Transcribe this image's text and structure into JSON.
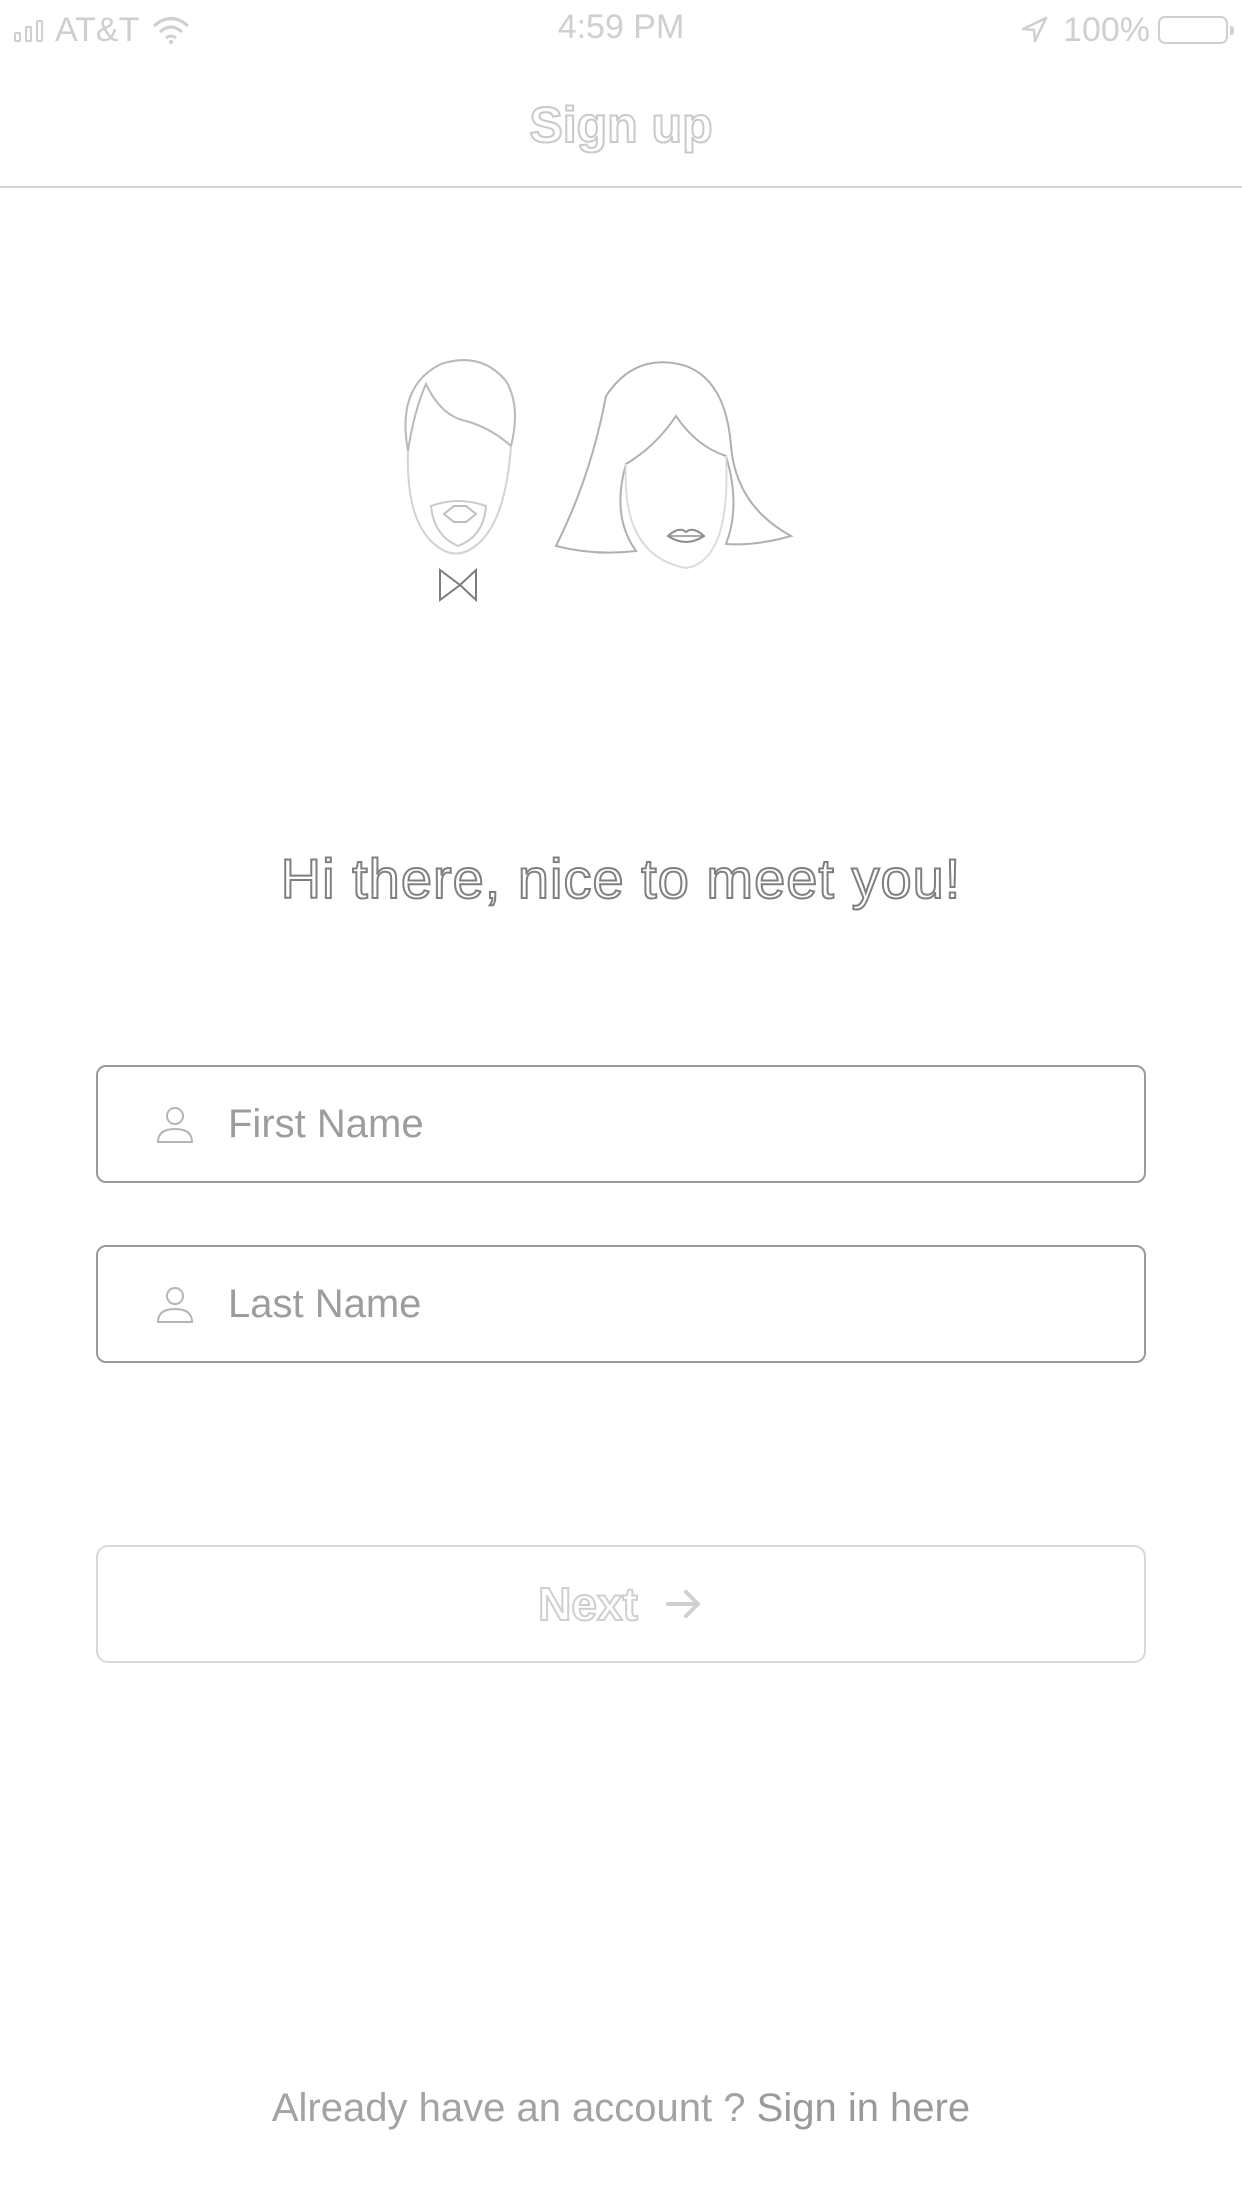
{
  "status_bar": {
    "carrier": "AT&T",
    "time": "4:59 PM",
    "battery": "100%",
    "icons": [
      "signal-icon",
      "wifi-icon",
      "location-arrow-icon",
      "battery-icon"
    ]
  },
  "nav": {
    "title": "Sign up"
  },
  "illustration": {
    "icon": "couple-faces-icon"
  },
  "greeting": "Hi there, nice to meet you!",
  "form": {
    "first_name": {
      "placeholder": "First Name",
      "value": "",
      "icon": "person-icon"
    },
    "last_name": {
      "placeholder": "Last Name",
      "value": "",
      "icon": "person-icon"
    }
  },
  "next_button": {
    "label": "Next",
    "icon": "arrow-right-icon"
  },
  "footer": {
    "prompt": "Already have an account ?",
    "link": "Sign in here"
  },
  "colors": {
    "border": "#9a9a9a",
    "muted_text": "#a3a3a3",
    "disabled": "#d8d8d8"
  }
}
